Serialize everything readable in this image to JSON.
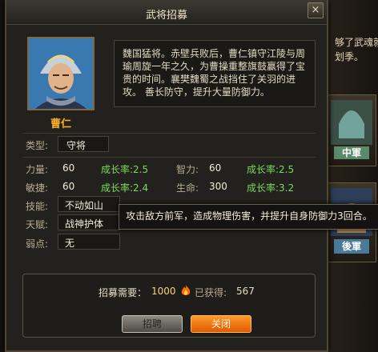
{
  "window": {
    "title": "武将招募",
    "close_glyph": "×"
  },
  "general": {
    "name": "曹仁",
    "description": "魏国猛将。赤壁兵败后，曹仁镇守江陵与周瑜周旋一年之久，为曹操重整旗鼓赢得了宝贵的时间。襄樊魏蜀之战挡住了关羽的进攻。 善长防守，提升大量防御力。"
  },
  "info": {
    "type_label": "类型:",
    "type_value": "守将",
    "strength_label": "力量:",
    "strength_value": "60",
    "strength_growth": "成长率:2.5",
    "intellect_label": "智力:",
    "intellect_value": "60",
    "intellect_growth": "成长率:2.5",
    "agility_label": "敏捷:",
    "agility_value": "60",
    "agility_growth": "成长率:2.4",
    "life_label": "生命:",
    "life_value": "300",
    "life_growth": "成长率:3.2",
    "skill_label": "技能:",
    "skill_value": "不动如山",
    "talent_label": "天赋:",
    "talent_value": "战神护体",
    "weakness_label": "弱点:",
    "weakness_value": "无"
  },
  "tooltip": {
    "text": "攻击敌方前军，造成物理伤害，并提升自身防御力3回合。"
  },
  "footer": {
    "cost_label": "招募需要：",
    "cost_value": "1000",
    "owned_label": "已获得:",
    "owned_value": "567",
    "recruit_button": "招聘",
    "close_button": "关闭"
  },
  "background": {
    "hint_line1": "够了武魂就",
    "hint_line2": "划季。",
    "card_banner_1": "中軍",
    "card_banner_2": "後軍"
  },
  "colors": {
    "name": "#ffb327",
    "growth": "#7cd95b",
    "close_button": "#ff7a10"
  }
}
